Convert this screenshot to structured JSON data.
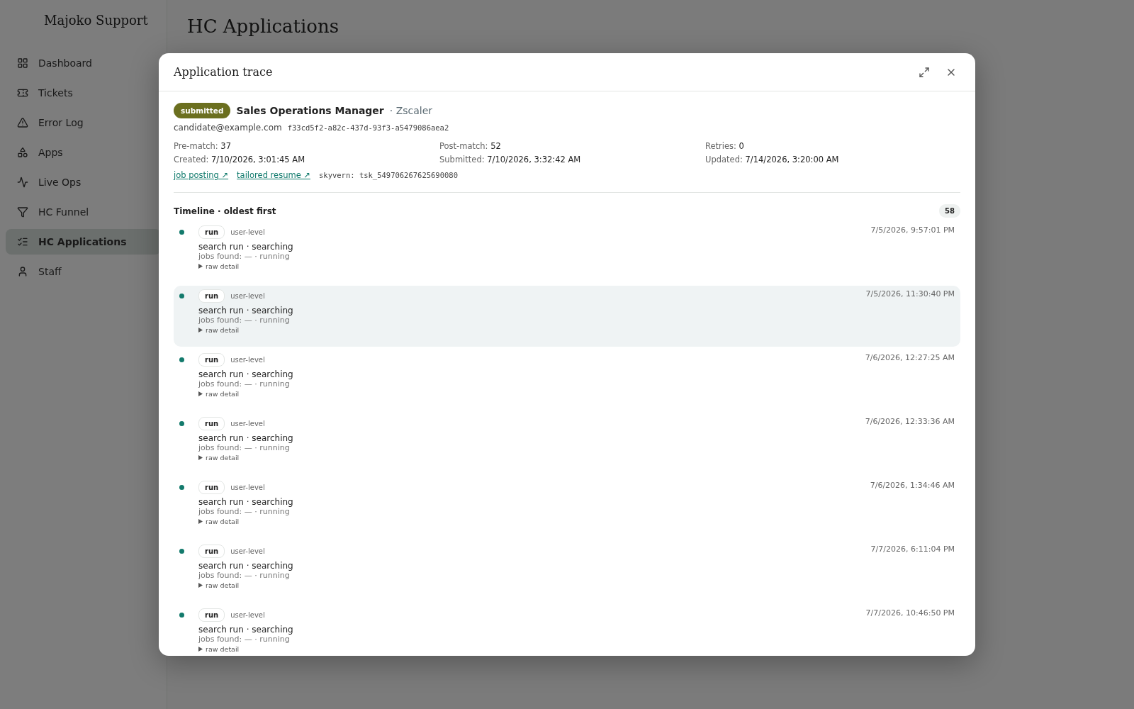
{
  "background": {
    "brand": "Majoko Support",
    "nav": [
      {
        "label": "Dashboard",
        "selected": false
      },
      {
        "label": "Tickets",
        "selected": false
      },
      {
        "label": "Error Log",
        "selected": false
      },
      {
        "label": "Apps",
        "selected": false
      },
      {
        "label": "Live Ops",
        "selected": false
      },
      {
        "label": "HC Funnel",
        "selected": false
      },
      {
        "label": "HC Applications",
        "selected": true
      },
      {
        "label": "Staff",
        "selected": false
      }
    ],
    "page_title": "HC Applications"
  },
  "dialog": {
    "title": "Application trace",
    "status": "submitted",
    "job_title": "Sales Operations Manager",
    "separator": "·",
    "company": "Zscaler",
    "email": "candidate@example.com",
    "id": "f33cd5f2-a82c-437d-93f3-a5479086aea2",
    "stats": [
      {
        "label": "Pre-match:",
        "value": "37"
      },
      {
        "label": "Post-match:",
        "value": "52"
      },
      {
        "label": "Retries:",
        "value": "0"
      },
      {
        "label": "Created:",
        "value": "7/10/2026, 3:01:45 AM"
      },
      {
        "label": "Submitted:",
        "value": "7/10/2026, 3:32:42 AM"
      },
      {
        "label": "Updated:",
        "value": "7/14/2026, 3:20:00 AM"
      }
    ],
    "links": [
      "job posting ↗",
      "tailored resume ↗"
    ],
    "task": "skyvern: tsk_549706267625690080",
    "timeline": {
      "title": "Timeline · oldest first",
      "count": "58",
      "events": [
        {
          "tag": "run",
          "level": "user-level",
          "time": "7/5/2026, 9:57:01 PM",
          "summary": "search run · searching",
          "detail": "jobs found: — · running",
          "toggle": "raw detail",
          "highlighted": false
        },
        {
          "tag": "run",
          "level": "user-level",
          "time": "7/5/2026, 11:30:40 PM",
          "summary": "search run · searching",
          "detail": "jobs found: — · running",
          "toggle": "raw detail",
          "highlighted": true
        },
        {
          "tag": "run",
          "level": "user-level",
          "time": "7/6/2026, 12:27:25 AM",
          "summary": "search run · searching",
          "detail": "jobs found: — · running",
          "toggle": "raw detail",
          "highlighted": false
        },
        {
          "tag": "run",
          "level": "user-level",
          "time": "7/6/2026, 12:33:36 AM",
          "summary": "search run · searching",
          "detail": "jobs found: — · running",
          "toggle": "raw detail",
          "highlighted": false
        },
        {
          "tag": "run",
          "level": "user-level",
          "time": "7/6/2026, 1:34:46 AM",
          "summary": "search run · searching",
          "detail": "jobs found: — · running",
          "toggle": "raw detail",
          "highlighted": false
        },
        {
          "tag": "run",
          "level": "user-level",
          "time": "7/7/2026, 6:11:04 PM",
          "summary": "search run · searching",
          "detail": "jobs found: — · running",
          "toggle": "raw detail",
          "highlighted": false
        },
        {
          "tag": "run",
          "level": "user-level",
          "time": "7/7/2026, 10:46:50 PM",
          "summary": "search run · searching",
          "detail": "jobs found: — · running",
          "toggle": "raw detail",
          "highlighted": false
        }
      ]
    }
  }
}
